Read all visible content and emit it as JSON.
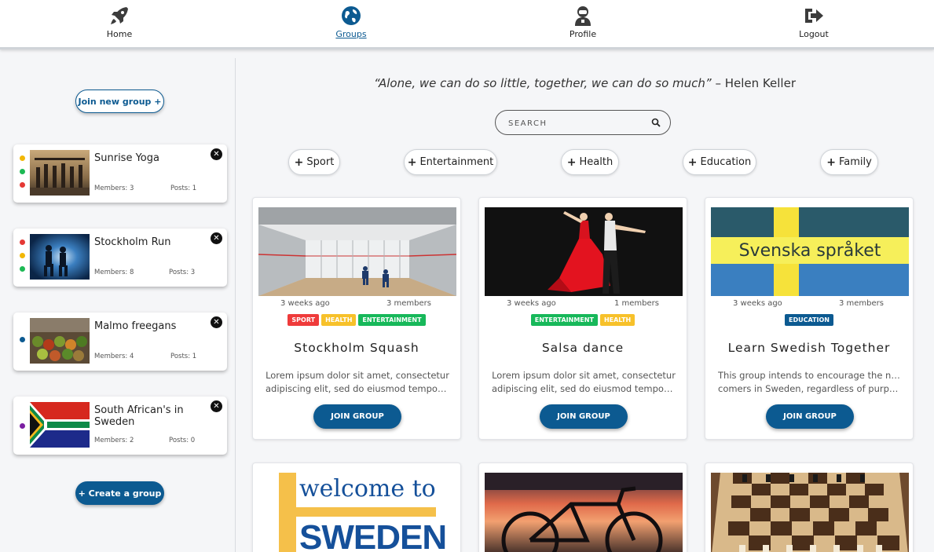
{
  "nav": {
    "items": [
      {
        "label": "Home",
        "icon": "rocket-icon"
      },
      {
        "label": "Groups",
        "icon": "globe-icon"
      },
      {
        "label": "Profile",
        "icon": "user-icon"
      },
      {
        "label": "Logout",
        "icon": "logout-icon"
      }
    ],
    "active": "Groups",
    "accent": "#0c5a91"
  },
  "sidebar": {
    "join_label": "Join new group +",
    "create_label": "+ Create a group",
    "groups": [
      {
        "name": "Sunrise Yoga",
        "members": "Members: 3",
        "posts": "Posts: 1",
        "dots": [
          "#f2b705",
          "#1db954",
          "#e53935"
        ]
      },
      {
        "name": "Stockholm Run",
        "members": "Members: 8",
        "posts": "Posts: 3",
        "dots": [
          "#e53935",
          "#f2b705",
          "#1db954"
        ]
      },
      {
        "name": "Malmo freegans",
        "members": "Members: 4",
        "posts": "Posts: 1",
        "dots": [
          "#0c5a91"
        ]
      },
      {
        "name": "South African's in Sweden",
        "members": "Members: 2",
        "posts": "Posts: 0",
        "dots": [
          "#7b1fa2"
        ]
      }
    ]
  },
  "main": {
    "quote": "“Alone, we can do so little, together, we can do so much”",
    "quote_author": " – Helen Keller",
    "search_placeholder": "SEARCH",
    "categories": [
      "Sport",
      "Entertainment",
      "Health",
      "Education",
      "Family"
    ],
    "join_label": "JOIN GROUP",
    "cards": [
      {
        "title": "Stockholm Squash",
        "time": "3 weeks ago",
        "members": "3 members",
        "tags": [
          {
            "label": "SPORT",
            "color": "#ef3b3b"
          },
          {
            "label": "HEALTH",
            "color": "#f7c12a"
          },
          {
            "label": "ENTERTAINMENT",
            "color": "#17b85a"
          }
        ],
        "desc1": "Lorem ipsum dolor sit amet, consectetur",
        "desc2": "adipiscing elit, sed do eiusmod tempor incididunt"
      },
      {
        "title": "Salsa dance",
        "time": "3 weeks ago",
        "members": "1 members",
        "tags": [
          {
            "label": "ENTERTAINMENT",
            "color": "#17b85a"
          },
          {
            "label": "HEALTH",
            "color": "#f7c12a"
          }
        ],
        "desc1": "Lorem ipsum dolor sit amet, consectetur",
        "desc2": "adipiscing elit, sed do eiusmod tempor incididunt"
      },
      {
        "title": "Learn Swedish Together",
        "time": "3 weeks ago",
        "members": "3 members",
        "tags": [
          {
            "label": "EDUCATION",
            "color": "#0c5a91"
          }
        ],
        "desc1": "This group intends to encourage the new",
        "desc2": "comers in Sweden, regardless of purpose of stay"
      }
    ],
    "banner_text_1": "Svenska språket",
    "banner_text_2": "welcome to",
    "banner_text_3": "SWEDEN"
  }
}
